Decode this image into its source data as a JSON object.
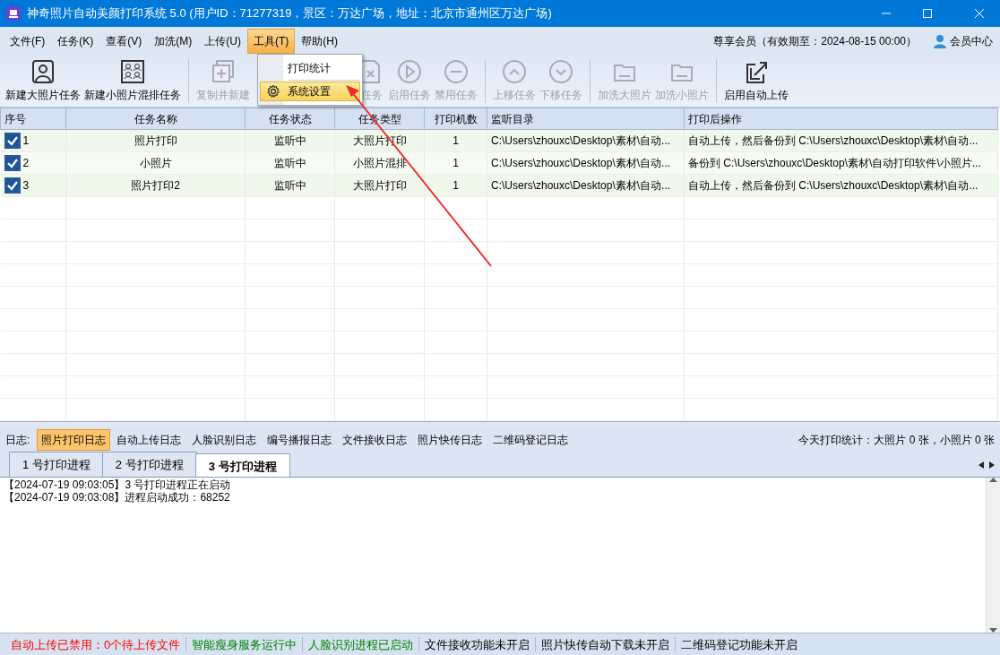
{
  "window": {
    "title": "神奇照片自动美颜打印系统 5.0 (用户ID：71277319，景区：万达广场，地址：北京市通州区万达广场)"
  },
  "menubar": {
    "items": [
      {
        "label": "文件(F)",
        "selected": false
      },
      {
        "label": "任务(K)",
        "selected": false
      },
      {
        "label": "查看(V)",
        "selected": false
      },
      {
        "label": "加洗(M)",
        "selected": false
      },
      {
        "label": "上传(U)",
        "selected": false
      },
      {
        "label": "工具(T)",
        "selected": true,
        "menu": [
          {
            "label": "打印统计",
            "selected": false,
            "kind": "plain"
          },
          {
            "label": "系统设置",
            "selected": true,
            "kind": "gear"
          }
        ]
      },
      {
        "label": "帮助(H)",
        "selected": false
      }
    ],
    "membership": "尊享会员（有效期至：2024-08-15 00:00）",
    "member_center": "会员中心"
  },
  "toolbar": {
    "groups": [
      [
        {
          "label": "新建大照片任务",
          "kind": "person",
          "disabled": false
        },
        {
          "label": "新建小照片混排任务",
          "kind": "group",
          "disabled": false
        }
      ],
      [
        {
          "label": "复制并新建",
          "kind": "copy",
          "disabled": true
        },
        {
          "label": "任务",
          "kind": "doc-x",
          "disabled": true
        },
        {
          "label": "启用任务",
          "kind": "play",
          "disabled": true
        },
        {
          "label": "禁用任务",
          "kind": "minus",
          "disabled": true
        }
      ],
      [
        {
          "label": "上移任务",
          "kind": "up",
          "disabled": true
        },
        {
          "label": "下移任务",
          "kind": "down",
          "disabled": true
        }
      ],
      [
        {
          "label": "加洗大照片",
          "kind": "folder",
          "disabled": true
        },
        {
          "label": "加洗小照片",
          "kind": "folder",
          "disabled": true
        }
      ],
      [
        {
          "label": "启用自动上传",
          "kind": "share",
          "disabled": false
        }
      ]
    ]
  },
  "table": {
    "columns": [
      "序号",
      "任务名称",
      "任务状态",
      "任务类型",
      "打印机数",
      "监听目录",
      "打印后操作"
    ],
    "rows": [
      {
        "checked": true,
        "cells": [
          "1",
          "照片打印",
          "监听中",
          "大照片打印",
          "1",
          "C:\\Users\\zhouxc\\Desktop\\素材\\自动...",
          "自动上传，然后备份到 C:\\Users\\zhouxc\\Desktop\\素材\\自动..."
        ]
      },
      {
        "checked": true,
        "cells": [
          "2",
          "小照片",
          "监听中",
          "小照片混排",
          "1",
          "C:\\Users\\zhouxc\\Desktop\\素材\\自动...",
          "备份到 C:\\Users\\zhouxc\\Desktop\\素材\\自动打印软件\\小照片..."
        ]
      },
      {
        "checked": true,
        "cells": [
          "3",
          "照片打印2",
          "监听中",
          "大照片打印",
          "1",
          "C:\\Users\\zhouxc\\Desktop\\素材\\自动...",
          "自动上传，然后备份到 C:\\Users\\zhouxc\\Desktop\\素材\\自动..."
        ]
      }
    ]
  },
  "log_bar": {
    "label": "日志:",
    "buttons": [
      {
        "label": "照片打印日志",
        "selected": true
      },
      {
        "label": "自动上传日志",
        "selected": false
      },
      {
        "label": "人脸识别日志",
        "selected": false
      },
      {
        "label": "编号播报日志",
        "selected": false
      },
      {
        "label": "文件接收日志",
        "selected": false
      },
      {
        "label": "照片快传日志",
        "selected": false
      },
      {
        "label": "二维码登记日志",
        "selected": false
      }
    ],
    "stats": "今天打印统计：大照片 0 张，小照片 0 张"
  },
  "log_tabs": [
    {
      "label": "1 号打印进程",
      "selected": false
    },
    {
      "label": "2 号打印进程",
      "selected": false
    },
    {
      "label": "3 号打印进程",
      "selected": true
    }
  ],
  "log_lines": [
    "【2024-07-19 09:03:05】3 号打印进程正在启动",
    "【2024-07-19 09:03:08】进程启动成功：68252"
  ],
  "status_bar": [
    {
      "text": "自动上传已禁用：0个待上传文件",
      "color": "#ff0000"
    },
    {
      "text": "智能瘦身服务运行中",
      "color": "#008000"
    },
    {
      "text": "人脸识别进程已启动",
      "color": "#008000"
    },
    {
      "text": "文件接收功能未开启",
      "color": "#000000"
    },
    {
      "text": "照片快传自动下载未开启",
      "color": "#000000"
    },
    {
      "text": "二维码登记功能未开启",
      "color": "#000000"
    }
  ]
}
